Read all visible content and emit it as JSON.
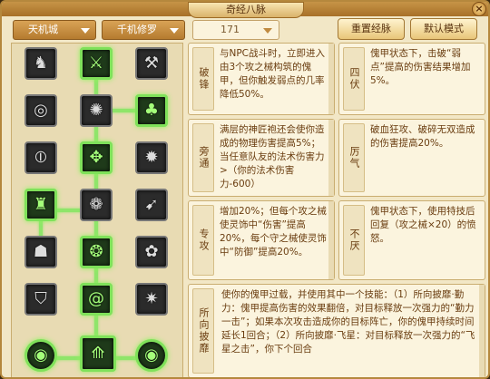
{
  "window": {
    "title": "奇经八脉",
    "close": "×"
  },
  "toolbar": {
    "school": "天机城",
    "type": "千机修罗",
    "level": "171",
    "reset_label": "重置经脉",
    "default_label": "默认模式"
  },
  "tree": {
    "icons": [
      "beast-icon",
      "slash-icon",
      "hammer-icon",
      "target-icon",
      "fire-icon",
      "green-tree-icon",
      "clamp-icon",
      "flame-claw-icon",
      "splash-icon",
      "guardian-icon",
      "gear-flower-icon",
      "speed-icon",
      "mask-icon",
      "spiral-box-icon",
      "flower-icon",
      "shield-icon",
      "vortex-icon",
      "burst-icon",
      "coil-left-icon",
      "crossbow-icon",
      "coil-right-icon"
    ],
    "active": [
      1,
      5,
      7,
      9,
      13,
      16,
      18,
      19,
      20
    ]
  },
  "abilities": [
    {
      "name": "破锋",
      "desc": "与NPC战斗时，立即进入由3个攻之械构筑的傀甲，但你触发弱点的几率降低50%。"
    },
    {
      "name": "四伏",
      "desc": "傀甲状态下，击破“弱点”提高的伤害结果增加5%。"
    },
    {
      "name": "旁通",
      "desc": "满层的神匠袍还会使你造成的物理伤害提高5%；当任意队友的法术伤害力>（你的法术伤害力-600）"
    },
    {
      "name": "厉气",
      "desc": "破血狂攻、破碎无双造成的伤害提高20%。"
    },
    {
      "name": "专攻",
      "desc": "增加20%；但每个攻之械使灵饰中“伤害”提高20%，每个守之械使灵饰中“防御”提高20%。"
    },
    {
      "name": "不厌",
      "desc": "傀甲状态下，使用特技后回复（攻之械×20）的愤怒。"
    },
    {
      "name": "所向披靡",
      "desc": "使你的傀甲过载，并使用其中一个技能：（1）所向披靡·勤力：傀甲提高伤害的效果翻倍，对目标释放一次强力的“勤力一击”；如果本次攻击造成你的目标阵亡，你的傀甲持续时间延长1回合；（2）所向披靡·飞星：对目标释放一次强力的“飞星之击”，你下个回合"
    }
  ]
}
